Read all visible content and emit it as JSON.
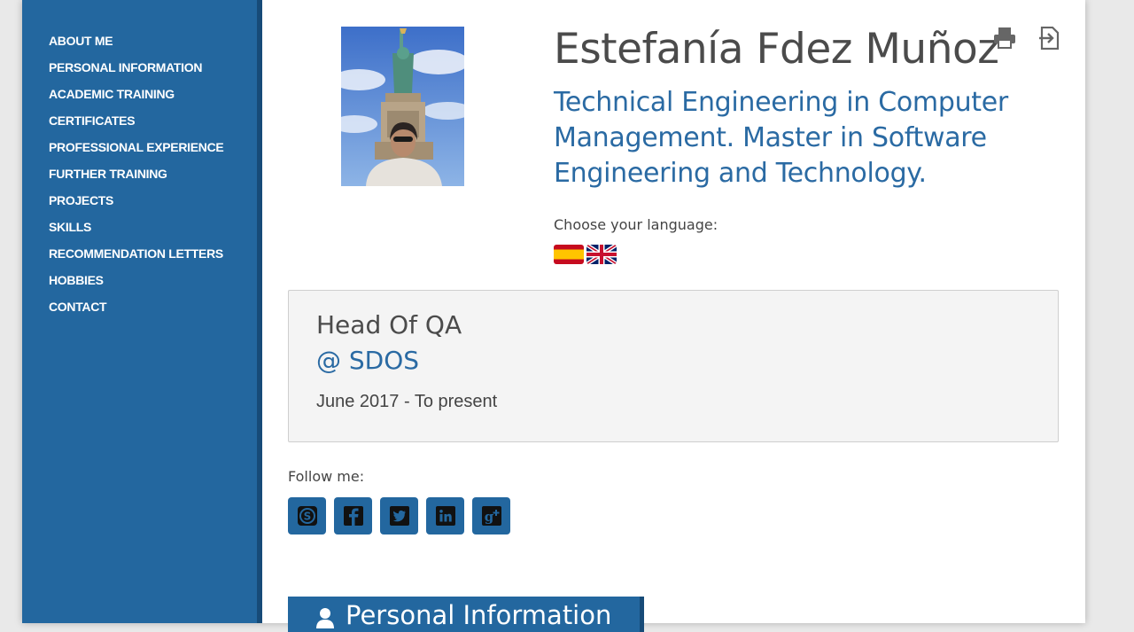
{
  "nav": {
    "items": [
      "ABOUT ME",
      "PERSONAL INFORMATION",
      "ACADEMIC TRAINING",
      "CERTIFICATES",
      "PROFESSIONAL EXPERIENCE",
      "FURTHER TRAINING",
      "PROJECTS",
      "SKILLS",
      "RECOMMENDATION LETTERS",
      "HOBBIES",
      "CONTACT"
    ]
  },
  "header": {
    "name": "Estefanía Fdez Muñoz",
    "subtitle": "Technical Engineering in Computer Management. Master in Software Engineering and Technology.",
    "tools": [
      "print-icon",
      "export-icon"
    ]
  },
  "language": {
    "label": "Choose your language:",
    "flags": [
      "spanish-flag-icon",
      "uk-flag-icon"
    ]
  },
  "job": {
    "title": "Head Of QA",
    "company": "@ SDOS",
    "dates": "June 2017 - To present"
  },
  "follow": {
    "label": "Follow me:",
    "networks": [
      "skype-icon",
      "facebook-icon",
      "twitter-icon",
      "linkedin-icon",
      "google-plus-icon"
    ]
  },
  "section": {
    "title": "Personal Information",
    "icon": "user-icon"
  },
  "colors": {
    "accent": "#23679f",
    "accent_dark": "#174b78",
    "link": "#2a6aa3",
    "text": "#4b4b4b",
    "panel_bg": "#f4f4f4"
  }
}
